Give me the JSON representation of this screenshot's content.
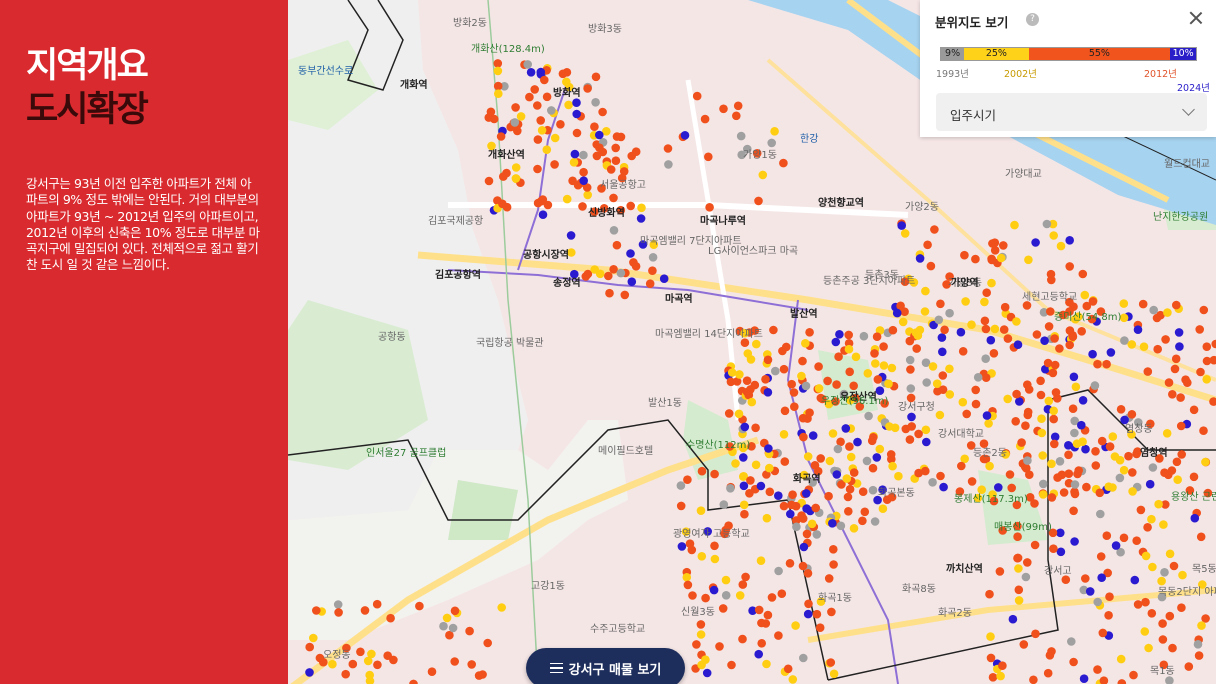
{
  "side": {
    "title_line1": "지역개요",
    "title_line2": "도시확장",
    "desc": "강서구는 93년 이전 입주한 아파트가 전체 아파트의 9% 정도 밖에는 안된다. 거의 대부분의 아파트가 93년 ~ 2012년 입주의 아파트이고, 2012년 이후의 신축은 10% 정도로 대부분 마곡지구에 밀집되어 있다. 전체적으로 젊고 활기찬 도시 일 것 같은 느낌이다."
  },
  "legend": {
    "title": "분위지도 보기",
    "help": "?",
    "segments": [
      {
        "label": "9%",
        "share": 9,
        "color": "#9a9a9a"
      },
      {
        "label": "25%",
        "share": 25,
        "color": "#ffd21a"
      },
      {
        "label": "55%",
        "share": 55,
        "color": "#f2541d"
      },
      {
        "label": "10%",
        "share": 10,
        "color": "#2a1ec9"
      }
    ],
    "years": [
      {
        "label": "1993년",
        "color": "#777777"
      },
      {
        "label": "2002년",
        "color": "#c79a00"
      },
      {
        "label": "2012년",
        "color": "#e0532a"
      },
      {
        "label": "2024년",
        "color": "#2a1ec9"
      }
    ],
    "select_value": "입주시기"
  },
  "list_button": "강서구 매물 보기",
  "map_labels": [
    {
      "t": "방화2동",
      "k": ""
    },
    {
      "t": "방화3동",
      "k": ""
    },
    {
      "t": "개화산(128.4m)",
      "k": "g"
    },
    {
      "t": "동부간선수로",
      "k": "bl"
    },
    {
      "t": "개화역",
      "k": "b"
    },
    {
      "t": "방화역",
      "k": "b"
    },
    {
      "t": "개화산역",
      "k": "b"
    },
    {
      "t": "서울공항고",
      "k": ""
    },
    {
      "t": "송정역",
      "k": "b"
    },
    {
      "t": "신방화역",
      "k": "b"
    },
    {
      "t": "마곡나루역",
      "k": "b"
    },
    {
      "t": "양천향교역",
      "k": "b"
    },
    {
      "t": "가양1동",
      "k": ""
    },
    {
      "t": "가양2동",
      "k": ""
    },
    {
      "t": "가양3동",
      "k": ""
    },
    {
      "t": "가양역",
      "k": "b"
    },
    {
      "t": "김포국제공항",
      "k": ""
    },
    {
      "t": "공항시장역",
      "k": "b"
    },
    {
      "t": "김포공항역",
      "k": "b"
    },
    {
      "t": "마곡역",
      "k": "b"
    },
    {
      "t": "마곡엠밸리 7단지아파트",
      "k": ""
    },
    {
      "t": "LG사이언스파크 마곡",
      "k": ""
    },
    {
      "t": "마곡엠밸리 14단지아파트",
      "k": ""
    },
    {
      "t": "등촌주공 3단지아파트",
      "k": ""
    },
    {
      "t": "등촌3동",
      "k": ""
    },
    {
      "t": "발산역",
      "k": "b"
    },
    {
      "t": "공항동",
      "k": ""
    },
    {
      "t": "국립항공 박물관",
      "k": ""
    },
    {
      "t": "우장산역",
      "k": "b"
    },
    {
      "t": "우장산(96.1m)",
      "k": "g"
    },
    {
      "t": "발산1동",
      "k": ""
    },
    {
      "t": "강서구청",
      "k": ""
    },
    {
      "t": "강서대학교",
      "k": ""
    },
    {
      "t": "등촌2동",
      "k": ""
    },
    {
      "t": "화곡역",
      "k": "b"
    },
    {
      "t": "화곡본동",
      "k": ""
    },
    {
      "t": "봉제산(117.3m)",
      "k": "g"
    },
    {
      "t": "까치산역",
      "k": "b"
    },
    {
      "t": "화곡1동",
      "k": ""
    },
    {
      "t": "화곡8동",
      "k": ""
    },
    {
      "t": "화곡2동",
      "k": ""
    },
    {
      "t": "인서울27 골프클럽",
      "k": "g"
    },
    {
      "t": "메이필드호텔",
      "k": ""
    },
    {
      "t": "수명산(112m)",
      "k": "g"
    },
    {
      "t": "광영여자 고등학교",
      "k": ""
    },
    {
      "t": "고강1동",
      "k": ""
    },
    {
      "t": "신월3동",
      "k": ""
    },
    {
      "t": "수주고등학교",
      "k": ""
    },
    {
      "t": "오정동",
      "k": ""
    },
    {
      "t": "가양대교",
      "k": ""
    },
    {
      "t": "월드컵대교",
      "k": ""
    },
    {
      "t": "난지한강공원",
      "k": "g"
    },
    {
      "t": "염창역",
      "k": "b"
    },
    {
      "t": "목동2단지 아파트",
      "k": ""
    },
    {
      "t": "목1동",
      "k": ""
    },
    {
      "t": "목5동",
      "k": ""
    },
    {
      "t": "용왕산 근린공원",
      "k": "g"
    },
    {
      "t": "세현고등학교",
      "k": ""
    },
    {
      "t": "증미산(54.8m)",
      "k": "g"
    },
    {
      "t": "염창동",
      "k": ""
    },
    {
      "t": "강서고",
      "k": ""
    },
    {
      "t": "매봉산(99m)",
      "k": "g"
    },
    {
      "t": "한강",
      "k": "bl"
    }
  ],
  "dot_colors": {
    "old": "#a0a0a0",
    "mid": "#ffce12",
    "main": "#f0501c",
    "new": "#2b1bd0"
  }
}
